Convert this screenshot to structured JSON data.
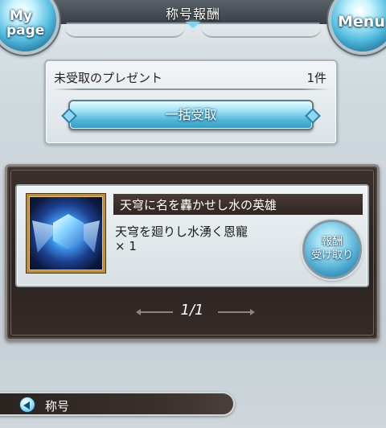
{
  "header": {
    "title": "称号報酬",
    "mypage_line1": "My",
    "mypage_line2": "page",
    "menu_label": "Menu"
  },
  "present": {
    "label": "未受取のプレゼント",
    "count": "1件",
    "collect_all_label": "一括受取"
  },
  "reward": {
    "title_name": "天穹に名を轟かせし水の英雄",
    "item_name": "天穹を廻りし水湧く恩寵",
    "item_qty": "× 1",
    "receive_line1": "報酬",
    "receive_line2": "受け取り",
    "icon": "water-title-emblem-icon"
  },
  "pager": {
    "text": "1/1"
  },
  "bottom_nav": {
    "label": "称号",
    "icon": "back-arrow-icon"
  },
  "colors": {
    "accent_blue": "#4fb5d8",
    "panel_dark": "#2b2321",
    "background": "#cfd9de"
  }
}
